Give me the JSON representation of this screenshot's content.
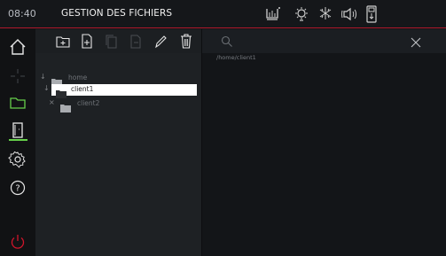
{
  "header": {
    "time": "08:40",
    "title": "GESTION DES FICHIERS"
  },
  "status_icons": [
    "temperature-icon",
    "light-bulb-icon",
    "fan-icon",
    "speaker-icon",
    "usb-drive-icon"
  ],
  "sidebar": {
    "items": [
      "home-icon",
      "move-icon",
      "folder-icon",
      "door-icon",
      "settings-icon",
      "help-icon",
      "power-icon"
    ],
    "active": "door-icon"
  },
  "toolbar": {
    "buttons": [
      "new-folder-button",
      "new-file-button",
      "copy-button",
      "paste-button",
      "rename-button",
      "delete-button"
    ]
  },
  "browser": {
    "current_path": "/home/client1"
  },
  "tree": {
    "items": [
      {
        "label": "home",
        "arrow": "↓"
      },
      {
        "label": "client1",
        "arrow": "↓",
        "selected": true
      },
      {
        "label": "client2",
        "arrow": "×"
      }
    ]
  },
  "colors": {
    "accent_red": "#b0182c",
    "accent_green": "#66d04a"
  }
}
